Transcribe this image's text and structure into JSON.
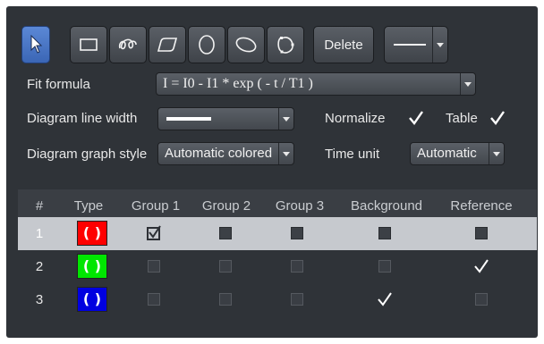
{
  "toolbar": {
    "tools": [
      {
        "name": "select-tool",
        "icon": "arrow-pointer-icon",
        "active": true
      },
      {
        "name": "rectangle-tool",
        "icon": "rectangle-icon"
      },
      {
        "name": "freehand-tool",
        "icon": "freehand-loop-icon"
      },
      {
        "name": "polygon-tool",
        "icon": "polygon-icon"
      },
      {
        "name": "ellipse-tool",
        "icon": "ellipse-icon"
      },
      {
        "name": "rotated-ellipse-tool",
        "icon": "rotated-ellipse-icon"
      },
      {
        "name": "spline-tool",
        "icon": "closed-spline-icon"
      }
    ],
    "delete_label": "Delete",
    "line_style": "solid"
  },
  "form": {
    "fit_formula_label": "Fit formula",
    "fit_formula_value": "I = I0 - I1 * exp ( - t / T1 )",
    "line_width_label": "Diagram line width",
    "normalize_label": "Normalize",
    "normalize_checked": true,
    "table_label": "Table",
    "table_checked": true,
    "graph_style_label": "Diagram graph style",
    "graph_style_value": "Automatic colored",
    "time_unit_label": "Time unit",
    "time_unit_value": "Automatic"
  },
  "table": {
    "columns": [
      "#",
      "Type",
      "Group 1",
      "Group 2",
      "Group 3",
      "Background",
      "Reference"
    ],
    "rows": [
      {
        "num": "1",
        "color": "#ff0000",
        "glyph": "( )",
        "glyph_color": "#ffffff",
        "checks": [
          true,
          false,
          false,
          false,
          false
        ],
        "selected": true
      },
      {
        "num": "2",
        "color": "#00e600",
        "glyph": "( )",
        "glyph_color": "#ffffff",
        "checks": [
          false,
          false,
          false,
          false,
          true
        ],
        "selected": false
      },
      {
        "num": "3",
        "color": "#0000e0",
        "glyph": "( )",
        "glyph_color": "#ffffff",
        "checks": [
          false,
          false,
          false,
          true,
          false
        ],
        "selected": false
      }
    ]
  },
  "colors": {
    "panel": "#2f3338",
    "active_tool": "#4a77c8",
    "selected_row": "#c6c9ce"
  }
}
